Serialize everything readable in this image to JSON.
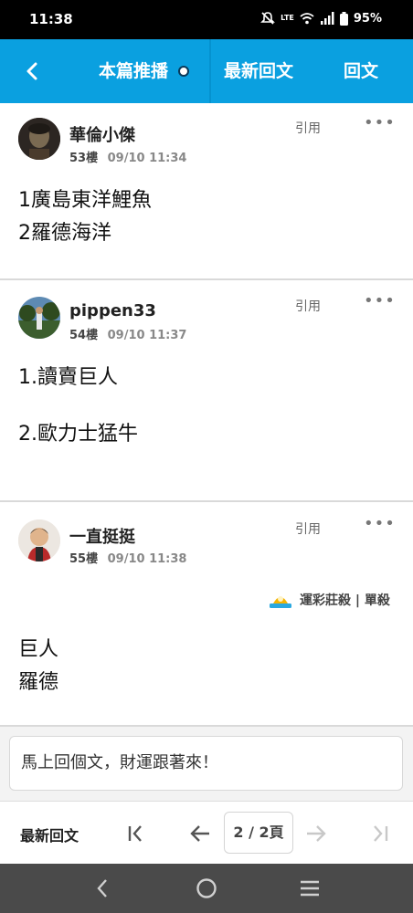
{
  "status": {
    "time": "11:38",
    "battery": "95%",
    "network": "LTE"
  },
  "app_bar": {
    "tab_current": "本篇推播",
    "tab_latest": "最新回文",
    "tab_reply": "回文"
  },
  "posts": [
    {
      "author": "華倫小傑",
      "floor": "53樓",
      "time": "09/10 11:34",
      "quote": "引用",
      "more": "•••",
      "lines": [
        "1廣島東洋鯉魚",
        "2羅德海洋"
      ]
    },
    {
      "author": "pippen33",
      "floor": "54樓",
      "time": "09/10 11:37",
      "quote": "引用",
      "more": "•••",
      "lines": [
        "1.讀賣巨人",
        "2.歐力士猛牛"
      ]
    },
    {
      "author": "一直挺挺",
      "floor": "55樓",
      "time": "09/10 11:38",
      "quote": "引用",
      "more": "•••",
      "signature": "運彩莊殺 | 單殺",
      "lines": [
        "巨人",
        "羅德"
      ]
    }
  ],
  "reply": {
    "placeholder": "馬上回個文，財運跟著來！"
  },
  "pager": {
    "latest_label": "最新回文",
    "page_label": "2 / 2頁"
  },
  "colors": {
    "brand": "#0aa0e0",
    "status_bar": "#000000",
    "nav_bar": "#4a4a4a"
  }
}
